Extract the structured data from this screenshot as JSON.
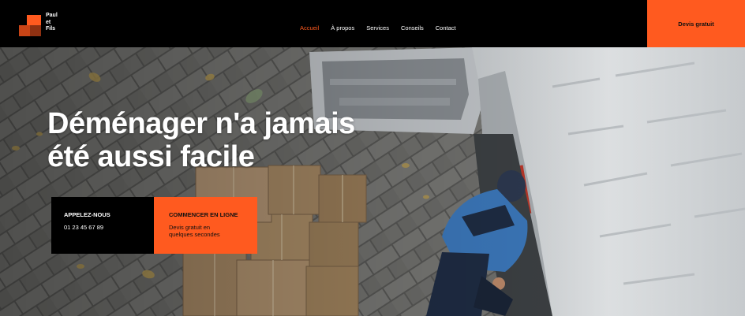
{
  "brand": {
    "name_lines": [
      "Paul",
      "et",
      "Fils"
    ],
    "colors": {
      "accent": "#ff5a1f",
      "dark": "#000000"
    }
  },
  "nav": {
    "items": [
      {
        "label": "Accueil",
        "active": true
      },
      {
        "label": "À propos",
        "active": false
      },
      {
        "label": "Services",
        "active": false
      },
      {
        "label": "Conseils",
        "active": false
      },
      {
        "label": "Contact",
        "active": false
      }
    ]
  },
  "header": {
    "quote_button_label": "Devis gratuit"
  },
  "hero": {
    "headline_lines": [
      "Déménager n'a jamais",
      "été aussi facile"
    ],
    "call_box": {
      "title": "APPELEZ-NOUS",
      "phone": "01 23 45 67 89"
    },
    "online_box": {
      "title": "COMMENCER EN LIGNE",
      "subtitle": "Devis gratuit en quelques secondes"
    }
  }
}
